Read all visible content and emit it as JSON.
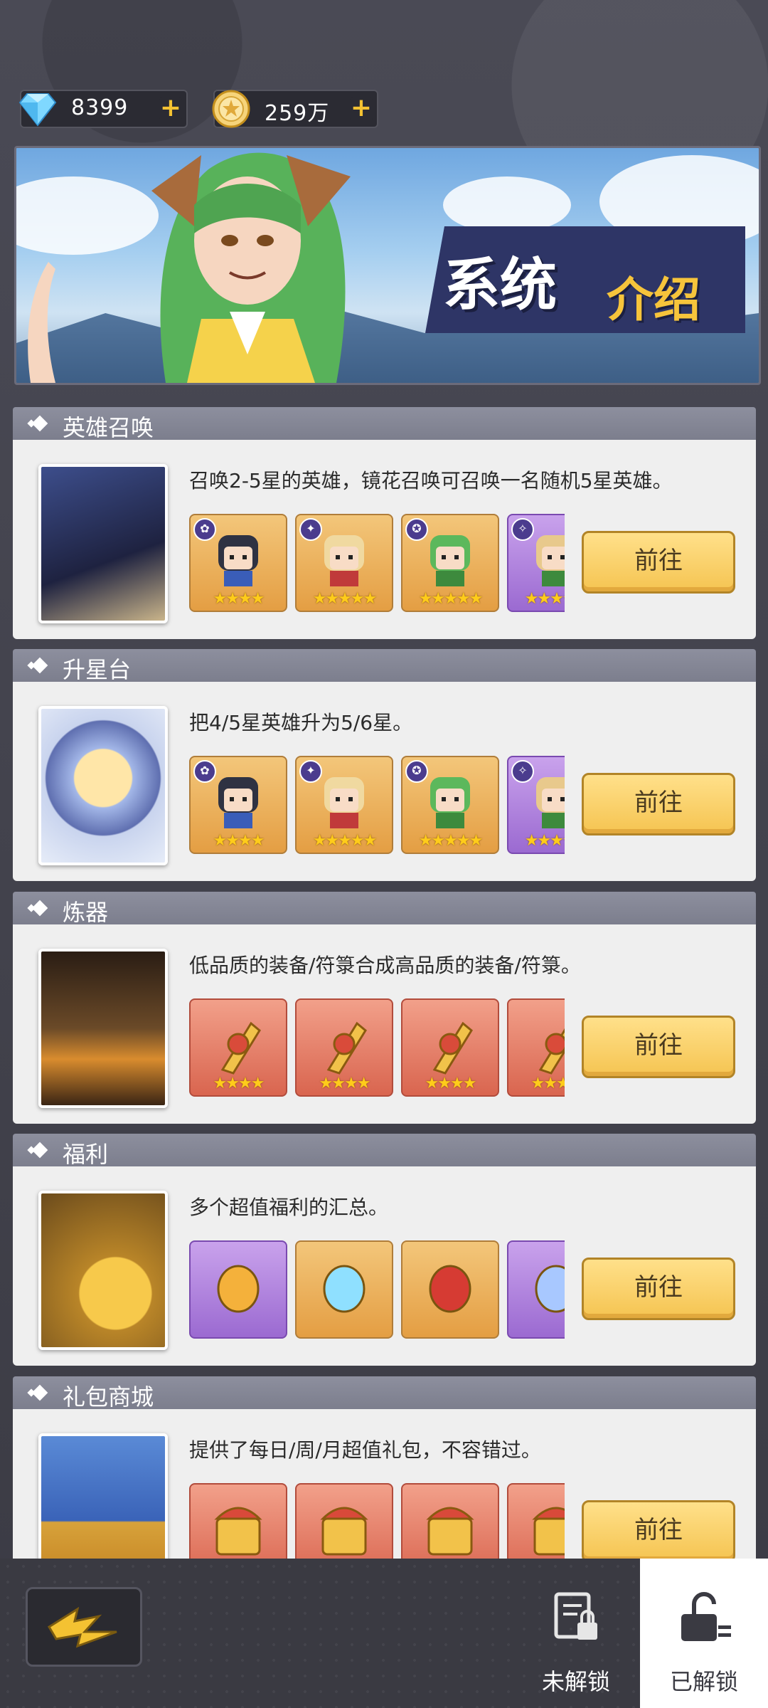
{
  "currency": {
    "diamonds": "8399",
    "coins": "259万"
  },
  "banner": {
    "title_part1": "系统",
    "title_part2": "介绍"
  },
  "sections": [
    {
      "title": "英雄召唤",
      "description": "召唤2-5星的英雄，镜花召唤可召唤一名随机5星英雄。",
      "button": "前往",
      "items": [
        "hero-dark-hair",
        "hero-blonde",
        "hero-green-hair",
        "hero-partial"
      ]
    },
    {
      "title": "升星台",
      "description": "把4/5星英雄升为5/6星。",
      "button": "前往",
      "items": [
        "hero-dark-hair",
        "hero-blonde",
        "hero-green-hair",
        "hero-partial"
      ]
    },
    {
      "title": "炼器",
      "description": "低品质的装备/符箓合成高品质的装备/符箓。",
      "button": "前往",
      "items": [
        "weapon",
        "armor",
        "ring",
        "boots"
      ]
    },
    {
      "title": "福利",
      "description": "多个超值福利的汇总。",
      "button": "前往",
      "items": [
        "tulip-token",
        "diamond",
        "red-ticket",
        "star"
      ]
    },
    {
      "title": "礼包商城",
      "description": "提供了每日/周/月超值礼包，不容错过。",
      "button": "前往",
      "items": [
        "gift-chest",
        "gem-chest",
        "all-chest",
        "chest-partial"
      ]
    }
  ],
  "bottom_tabs": {
    "locked": "未解锁",
    "unlocked": "已解锁"
  },
  "colors": {
    "accent_gold": "#f5c451",
    "header_gray": "#8d8f9e",
    "active_tab": "#ffffff"
  }
}
